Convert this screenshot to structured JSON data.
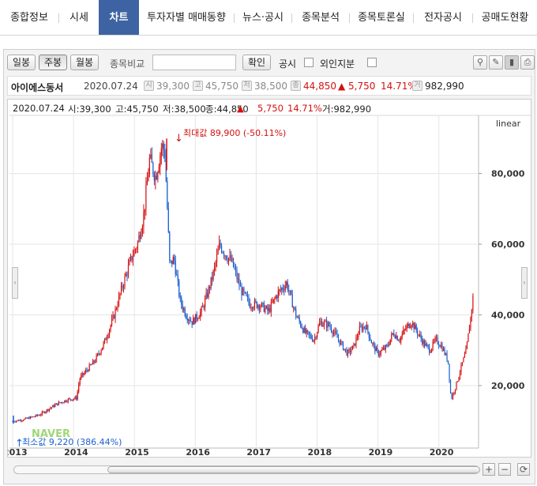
{
  "tabs": [
    {
      "label": "종합정보",
      "active": false
    },
    {
      "label": "시세",
      "active": false
    },
    {
      "label": "차트",
      "active": true
    },
    {
      "label": "투자자별 매매동향",
      "active": false
    },
    {
      "label": "뉴스·공시",
      "active": false
    },
    {
      "label": "종목분석",
      "active": false
    },
    {
      "label": "종목토론실",
      "active": false
    },
    {
      "label": "전자공시",
      "active": false
    },
    {
      "label": "공매도현황",
      "active": false
    }
  ],
  "toolbar": {
    "period_buttons": [
      "일봉",
      "주봉",
      "월봉"
    ],
    "selected_period": "주봉",
    "compare_label": "종목비교",
    "compare_value": "",
    "confirm_label": "확인",
    "disclosure_label": "공시",
    "foreign_label": "외인지분",
    "icons": [
      "pin-icon",
      "edit-icon",
      "chart-toggle-icon",
      "print-icon"
    ]
  },
  "stock_info": {
    "name": "아이에스동서",
    "date": "2020.07.24",
    "open_badge": "시",
    "open": "39,300",
    "high_badge": "고",
    "high": "45,750",
    "low_badge": "저",
    "low": "38,500",
    "close_badge": "종",
    "close": "44,850",
    "change": "▲ 5,750",
    "change_pct": "14.71%",
    "volume_badge": "거",
    "volume": "982,990"
  },
  "chart_header": {
    "date": "2020.07.24",
    "open": "시:39,300",
    "high": "고:45,750",
    "low": "저:38,500",
    "close": "종:44,850",
    "arrow": "▲",
    "change": "5,750",
    "change_pct": "14.71%",
    "volume": "거:982,990"
  },
  "colors": {
    "up": "#d61010",
    "down": "#1a5fd0",
    "accent_tab": "#3e63a2",
    "grid": "#e5e5e5"
  },
  "chart_data": {
    "type": "candlestick",
    "scale_label": "linear",
    "x_tick_labels": [
      "2013",
      "2014",
      "2015",
      "2016",
      "2017",
      "2018",
      "2019",
      "2020"
    ],
    "y_tick_labels": [
      "20,000",
      "40,000",
      "60,000",
      "80,000"
    ],
    "y_ticks": [
      20000,
      40000,
      60000,
      80000
    ],
    "ylim": [
      3000,
      96000
    ],
    "xlim": [
      2013.0,
      2020.6
    ],
    "max_annotation": "최대값 89,900 (-50.11%)",
    "min_annotation": "최소값 9,220 (386.44%)",
    "max_point": {
      "x": 2015.53,
      "y": 89900
    },
    "min_point": {
      "x": 2013.0,
      "y": 9220
    },
    "watermark": "NAVER",
    "series": [
      {
        "name": "close (weekly, approx.)",
        "points": [
          [
            2013.0,
            9900
          ],
          [
            2013.15,
            10300
          ],
          [
            2013.3,
            11000
          ],
          [
            2013.45,
            11800
          ],
          [
            2013.6,
            13500
          ],
          [
            2013.75,
            15000
          ],
          [
            2013.9,
            16000
          ],
          [
            2014.05,
            16500
          ],
          [
            2014.1,
            22000
          ],
          [
            2014.2,
            24000
          ],
          [
            2014.35,
            27000
          ],
          [
            2014.5,
            32000
          ],
          [
            2014.65,
            39000
          ],
          [
            2014.8,
            48000
          ],
          [
            2014.95,
            56000
          ],
          [
            2015.05,
            60000
          ],
          [
            2015.15,
            68000
          ],
          [
            2015.25,
            84000
          ],
          [
            2015.35,
            79000
          ],
          [
            2015.45,
            88000
          ],
          [
            2015.5,
            86000
          ],
          [
            2015.58,
            54000
          ],
          [
            2015.65,
            56000
          ],
          [
            2015.75,
            44000
          ],
          [
            2015.85,
            40000
          ],
          [
            2015.95,
            38000
          ],
          [
            2016.1,
            41000
          ],
          [
            2016.2,
            46000
          ],
          [
            2016.3,
            52000
          ],
          [
            2016.4,
            60000
          ],
          [
            2016.5,
            57000
          ],
          [
            2016.6,
            55000
          ],
          [
            2016.75,
            47000
          ],
          [
            2016.9,
            43000
          ],
          [
            2017.05,
            43000
          ],
          [
            2017.2,
            41000
          ],
          [
            2017.35,
            46000
          ],
          [
            2017.5,
            49000
          ],
          [
            2017.65,
            40000
          ],
          [
            2017.8,
            35000
          ],
          [
            2017.95,
            33000
          ],
          [
            2018.05,
            38000
          ],
          [
            2018.2,
            37000
          ],
          [
            2018.35,
            33000
          ],
          [
            2018.5,
            29000
          ],
          [
            2018.6,
            31000
          ],
          [
            2018.7,
            36000
          ],
          [
            2018.8,
            37000
          ],
          [
            2018.9,
            32000
          ],
          [
            2019.0,
            29000
          ],
          [
            2019.15,
            31000
          ],
          [
            2019.25,
            35000
          ],
          [
            2019.35,
            33000
          ],
          [
            2019.45,
            36000
          ],
          [
            2019.55,
            38000
          ],
          [
            2019.65,
            35000
          ],
          [
            2019.75,
            32000
          ],
          [
            2019.85,
            30000
          ],
          [
            2019.95,
            33000
          ],
          [
            2020.05,
            31000
          ],
          [
            2020.15,
            27000
          ],
          [
            2020.2,
            16000
          ],
          [
            2020.28,
            20000
          ],
          [
            2020.38,
            26000
          ],
          [
            2020.45,
            30000
          ],
          [
            2020.52,
            39000
          ],
          [
            2020.56,
            44850
          ]
        ]
      }
    ]
  }
}
